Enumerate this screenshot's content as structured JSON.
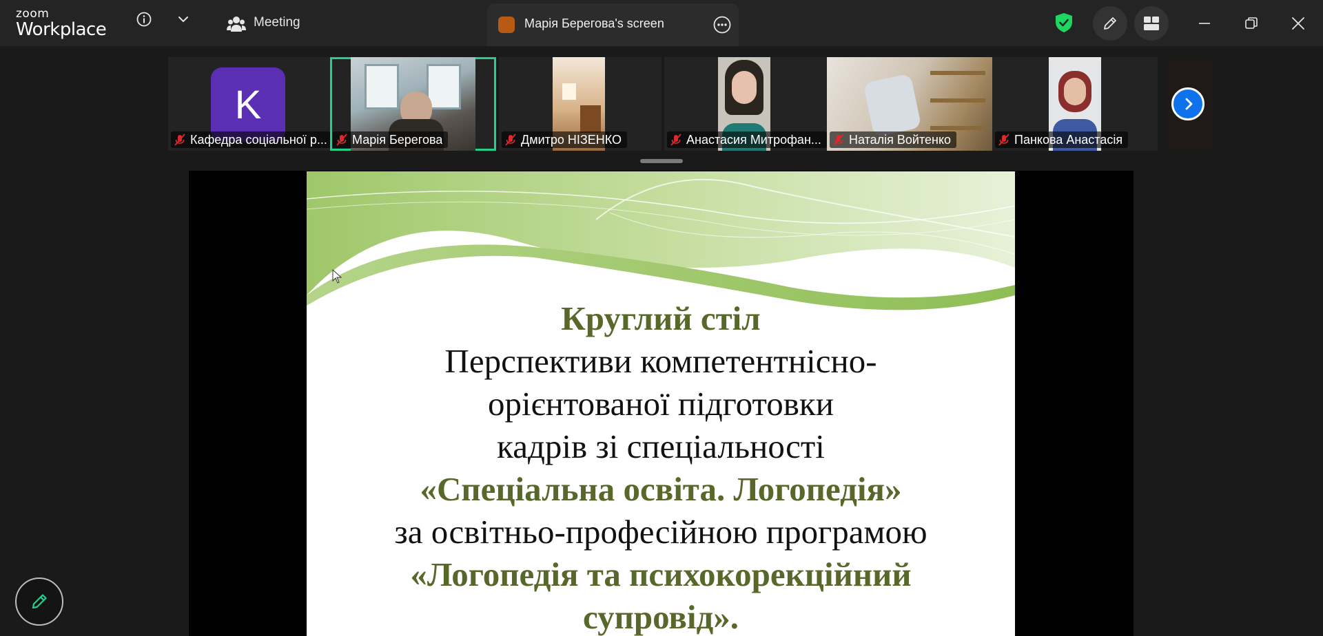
{
  "app": {
    "logo_top": "zoom",
    "logo_bottom": "Workplace"
  },
  "titlebar": {
    "meeting_label": "Meeting",
    "share_tab_label": "Марія Берегова's screen"
  },
  "gallery": {
    "participants": [
      {
        "name": "Кафедра соціальної р...",
        "avatar_letter": "K",
        "muted": true
      },
      {
        "name": "Марія Берегова",
        "muted": true,
        "active_speaker": true
      },
      {
        "name": "Дмитро НІЗЕНКО",
        "muted": true
      },
      {
        "name": "Анастасия Митрофан...",
        "muted": true
      },
      {
        "name": "Наталія Войтенко",
        "muted": true
      },
      {
        "name": "Панкова Анастасія",
        "muted": true
      }
    ]
  },
  "slide": {
    "line1": "Круглий стіл",
    "line2": "Перспективи компетентнісно-",
    "line3": "орієнтованої підготовки",
    "line4": "кадрів зі спеціальності",
    "line5": "«Спеціальна освіта. Логопедія»",
    "line6": "за освітньо-професійною програмою",
    "line7": "«Логопедія та психокорекційний",
    "line8": "супровід»."
  },
  "colors": {
    "accent_green": "#23d18b",
    "shield_green": "#1ed760",
    "next_blue": "#0e72ed",
    "slide_title_green": "#58682b",
    "muted_red": "#e02828"
  },
  "icons": [
    "info-icon",
    "chevron-down-icon",
    "participants-icon",
    "more-icon",
    "shield-icon",
    "annotate-pencil-icon",
    "apps-grid-icon",
    "minimize-icon",
    "restore-icon",
    "close-icon",
    "mic-off-icon",
    "chevron-right-icon",
    "pencil-icon"
  ]
}
